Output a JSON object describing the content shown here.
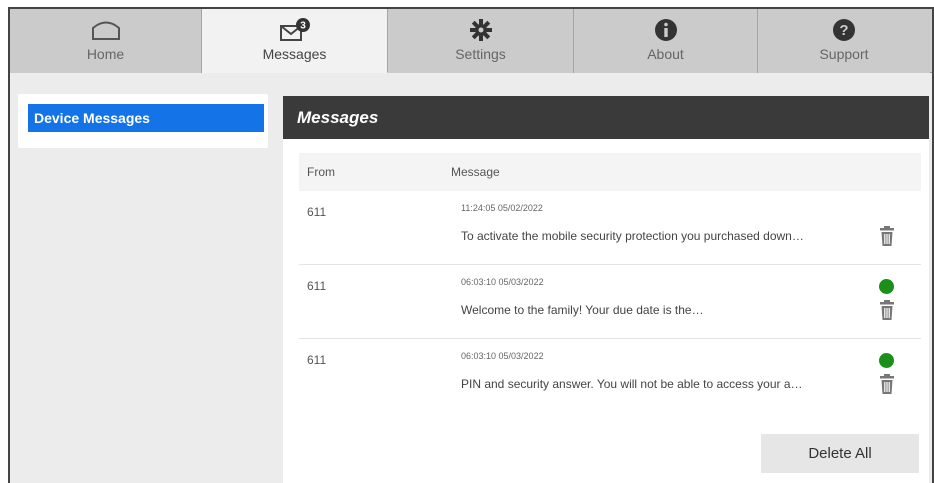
{
  "tabs": [
    {
      "label": "Home",
      "icon": "home-icon"
    },
    {
      "label": "Messages",
      "icon": "messages-icon",
      "badge": "3",
      "active": true
    },
    {
      "label": "Settings",
      "icon": "gear-icon"
    },
    {
      "label": "About",
      "icon": "info-icon"
    },
    {
      "label": "Support",
      "icon": "question-icon"
    }
  ],
  "sidebar": {
    "items": [
      {
        "label": "Device Messages",
        "selected": true
      }
    ]
  },
  "panel": {
    "title": "Messages",
    "columns": {
      "from": "From",
      "message": "Message"
    },
    "rows": [
      {
        "from": "611",
        "time": "11:24:05 05/02/2022",
        "text": "To activate the mobile security protection you purchased down…",
        "unread": false
      },
      {
        "from": "611",
        "time": "06:03:10 05/03/2022",
        "text": "Welcome to the family! Your due date is the…",
        "unread": true
      },
      {
        "from": "611",
        "time": "06:03:10 05/03/2022",
        "text": "PIN and security answer. You will not be able to access your a…",
        "unread": true
      }
    ],
    "delete_all_label": "Delete All"
  },
  "colors": {
    "accent": "#1473e6",
    "unread": "#1a8f1a",
    "header": "#3a3a3a"
  }
}
